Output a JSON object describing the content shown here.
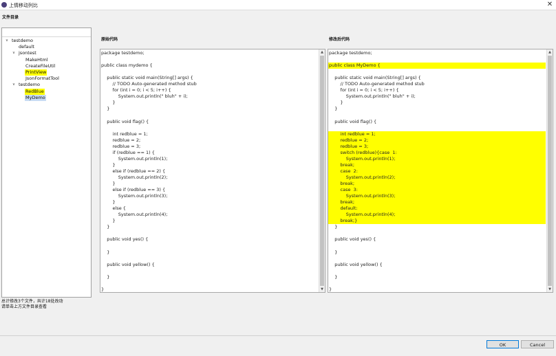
{
  "window": {
    "title": "上情移动列比",
    "close_symbol": "✕"
  },
  "file_directory_label": "文件目录",
  "tree": [
    {
      "label": "testdemo",
      "level": 0,
      "expanded": true,
      "highlight": ""
    },
    {
      "label": "default",
      "level": 1,
      "expanded": null,
      "highlight": ""
    },
    {
      "label": "jsontest",
      "level": 1,
      "expanded": true,
      "highlight": ""
    },
    {
      "label": "MakeHtml",
      "level": 2,
      "expanded": null,
      "highlight": ""
    },
    {
      "label": "CreateFileUtil",
      "level": 2,
      "expanded": null,
      "highlight": ""
    },
    {
      "label": "PrintView",
      "level": 2,
      "expanded": null,
      "highlight": "yellow"
    },
    {
      "label": "JsonFormatTool",
      "level": 2,
      "expanded": null,
      "highlight": ""
    },
    {
      "label": "testdemo",
      "level": 1,
      "expanded": true,
      "highlight": ""
    },
    {
      "label": "RedBlue",
      "level": 2,
      "expanded": null,
      "highlight": "yellow"
    },
    {
      "label": "MyDemo",
      "level": 2,
      "expanded": null,
      "highlight": "blue"
    }
  ],
  "notes": {
    "line1": "总计修改3个文件，共计18处改动",
    "line2": "请单击上方文件目录查看"
  },
  "original_label": "原始代码",
  "modified_label": "修改后代码",
  "original_code": [
    {
      "text": "package testdemo;",
      "hl": false
    },
    {
      "text": "",
      "hl": false
    },
    {
      "text": "public class mydemo {",
      "hl": false
    },
    {
      "text": "",
      "hl": false
    },
    {
      "text": "    public static void main(String[] args) {",
      "hl": false
    },
    {
      "text": "        // TODO Auto-generated method stub",
      "hl": false
    },
    {
      "text": "        for (int i = 0; i < 5; i++) {",
      "hl": false
    },
    {
      "text": "            System.out.println(\" bluh\" + i);",
      "hl": false
    },
    {
      "text": "        }",
      "hl": false
    },
    {
      "text": "    }",
      "hl": false
    },
    {
      "text": "",
      "hl": false
    },
    {
      "text": "    public void flag() {",
      "hl": false
    },
    {
      "text": "",
      "hl": false
    },
    {
      "text": "        int redblue = 1;",
      "hl": false
    },
    {
      "text": "        redblue = 2;",
      "hl": false
    },
    {
      "text": "        redblue = 3;",
      "hl": false
    },
    {
      "text": "        if (redblue == 1) {",
      "hl": false
    },
    {
      "text": "            System.out.println(1);",
      "hl": false
    },
    {
      "text": "        }",
      "hl": false
    },
    {
      "text": "        else if (redblue == 2) {",
      "hl": false
    },
    {
      "text": "            System.out.println(2);",
      "hl": false
    },
    {
      "text": "        }",
      "hl": false
    },
    {
      "text": "        else if (redblue == 3) {",
      "hl": false
    },
    {
      "text": "            System.out.println(3);",
      "hl": false
    },
    {
      "text": "        }",
      "hl": false
    },
    {
      "text": "        else {",
      "hl": false
    },
    {
      "text": "            System.out.println(4);",
      "hl": false
    },
    {
      "text": "        }",
      "hl": false
    },
    {
      "text": "    }",
      "hl": false
    },
    {
      "text": "",
      "hl": false
    },
    {
      "text": "    public void yes() {",
      "hl": false
    },
    {
      "text": "",
      "hl": false
    },
    {
      "text": "    }",
      "hl": false
    },
    {
      "text": "",
      "hl": false
    },
    {
      "text": "    public void yellow() {",
      "hl": false
    },
    {
      "text": "",
      "hl": false
    },
    {
      "text": "    }",
      "hl": false
    },
    {
      "text": "",
      "hl": false
    },
    {
      "text": "}",
      "hl": false
    }
  ],
  "modified_code": [
    {
      "text": "package testdemo;",
      "hl": false
    },
    {
      "text": "",
      "hl": false
    },
    {
      "text": "public class MyDemo {",
      "hl": true
    },
    {
      "text": "",
      "hl": false
    },
    {
      "text": "    public static void main(String[] args) {",
      "hl": false
    },
    {
      "text": "        // TODO Auto-generated method stub",
      "hl": false
    },
    {
      "text": "        for (int i = 0; i < 5; i++) {",
      "hl": false
    },
    {
      "text": "            System.out.println(\" bluh\" + i);",
      "hl": false
    },
    {
      "text": "        }",
      "hl": false
    },
    {
      "text": "    }",
      "hl": false
    },
    {
      "text": "",
      "hl": false
    },
    {
      "text": "    public void flag() {",
      "hl": false
    },
    {
      "text": "",
      "hl": false
    },
    {
      "text": "        int redblue = 1;",
      "hl": true
    },
    {
      "text": "        redblue = 2;",
      "hl": true
    },
    {
      "text": "        redblue = 3;",
      "hl": true
    },
    {
      "text": "        switch (redblue){case  1:",
      "hl": true
    },
    {
      "text": "            System.out.println(1);",
      "hl": true
    },
    {
      "text": "        break;",
      "hl": true
    },
    {
      "text": "        case  2:",
      "hl": true
    },
    {
      "text": "            System.out.println(2);",
      "hl": true
    },
    {
      "text": "        break;",
      "hl": true
    },
    {
      "text": "        case  3:",
      "hl": true
    },
    {
      "text": "            System.out.println(3);",
      "hl": true
    },
    {
      "text": "        break;",
      "hl": true
    },
    {
      "text": "        default:",
      "hl": true
    },
    {
      "text": "            System.out.println(4);",
      "hl": true
    },
    {
      "text": "        break;}",
      "hl": true
    },
    {
      "text": "    }",
      "hl": false
    },
    {
      "text": "",
      "hl": false
    },
    {
      "text": "    public void yes() {",
      "hl": false
    },
    {
      "text": "",
      "hl": false
    },
    {
      "text": "    }",
      "hl": false
    },
    {
      "text": "",
      "hl": false
    },
    {
      "text": "    public void yellow() {",
      "hl": false
    },
    {
      "text": "",
      "hl": false
    },
    {
      "text": "    }",
      "hl": false
    },
    {
      "text": "",
      "hl": false
    },
    {
      "text": "}",
      "hl": false
    }
  ],
  "scroll_arrows": {
    "up": "▲",
    "down": "▼"
  },
  "tree_toggle_symbol": "v",
  "buttons": {
    "ok": "OK",
    "cancel": "Cancel"
  },
  "colors": {
    "highlight_yellow": "#ffff00",
    "highlight_blue": "#c8dcf4",
    "ok_border": "#0078d7"
  }
}
